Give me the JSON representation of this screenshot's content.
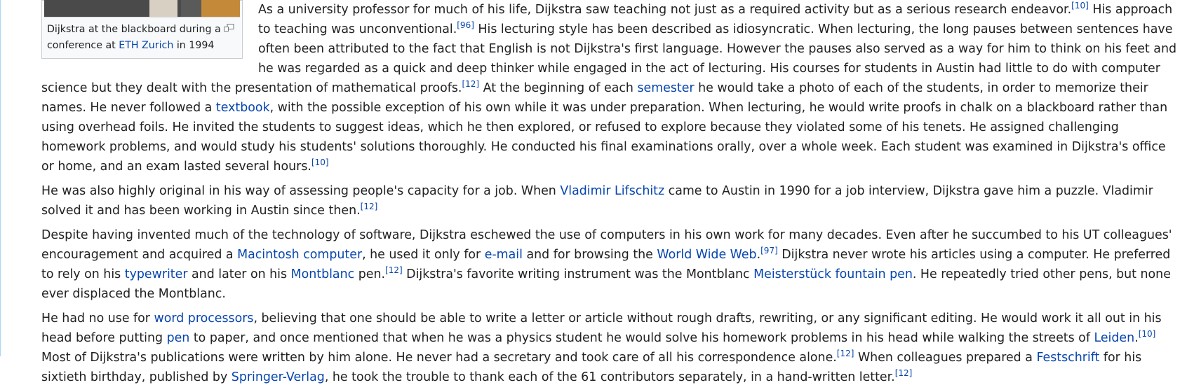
{
  "thumb": {
    "caption_pre": "Dijkstra at the blackboard during a conference at ",
    "caption_link": "ETH Zurich",
    "caption_post": " in 1994"
  },
  "paragraphs": {
    "p1": {
      "t1": "As a university professor for much of his life, Dijkstra saw teaching not just as a required activity but as a serious research endeavor.",
      "r1": "[10]",
      "t2": " His approach to teaching was unconventional.",
      "r2": "[96]",
      "t3": " His lecturing style has been described as idiosyncratic. When lecturing, the long pauses between sentences have often been attributed to the fact that English is not Dijkstra's first language. However the pauses also served as a way for him to think on his feet and he was regarded as a quick and deep thinker while engaged in the act of lecturing. His courses for students in Austin had little to do with computer science but they dealt with the presentation of mathematical proofs.",
      "r3": "[12]",
      "t4": " At the beginning of each ",
      "l1": "semester",
      "t5": " he would take a photo of each of the students, in order to memorize their names. He never followed a ",
      "l2": "textbook",
      "t6": ", with the possible exception of his own while it was under preparation. When lecturing, he would write proofs in chalk on a blackboard rather than using overhead foils. He invited the students to suggest ideas, which he then explored, or refused to explore because they violated some of his tenets. He assigned challenging homework problems, and would study his students' solutions thoroughly. He conducted his final examinations orally, over a whole week. Each student was examined in Dijkstra's office or home, and an exam lasted several hours.",
      "r4": "[10]"
    },
    "p2": {
      "t1": "He was also highly original in his way of assessing people's capacity for a job. When ",
      "l1": "Vladimir Lifschitz",
      "t2": " came to Austin in 1990 for a job interview, Dijkstra gave him a puzzle. Vladimir solved it and has been working in Austin since then.",
      "r1": "[12]"
    },
    "p3": {
      "t1": "Despite having invented much of the technology of software, Dijkstra eschewed the use of computers in his own work for many decades. Even after he succumbed to his UT colleagues' encouragement and acquired a ",
      "l1": "Macintosh computer",
      "t2": ", he used it only for ",
      "l2": "e-mail",
      "t3": " and for browsing the ",
      "l3": "World Wide Web",
      "t4": ".",
      "r1": "[97]",
      "t5": " Dijkstra never wrote his articles using a computer. He preferred to rely on his ",
      "l4": "typewriter",
      "t6": " and later on his ",
      "l5": "Montblanc",
      "t7": " pen.",
      "r2": "[12]",
      "t8": " Dijkstra's favorite writing instrument was the Montblanc ",
      "l6": "Meisterstück fountain pen",
      "t9": ". He repeatedly tried other pens, but none ever displaced the Montblanc."
    },
    "p4": {
      "t1": "He had no use for ",
      "l1": "word processors",
      "t2": ", believing that one should be able to write a letter or article without rough drafts, rewriting, or any significant editing. He would work it all out in his head before putting ",
      "l2": "pen",
      "t3": " to paper, and once mentioned that when he was a physics student he would solve his homework problems in his head while walking the streets of ",
      "l3": "Leiden",
      "t4": ".",
      "r1": "[10]",
      "t5": " Most of Dijkstra's publications were written by him alone. He never had a secretary and took care of all his correspondence alone.",
      "r2": "[12]",
      "t6": " When colleagues prepared a ",
      "l4": "Festschrift",
      "t7": " for his sixtieth birthday, published by ",
      "l5": "Springer-Verlag",
      "t8": ", he took the trouble to thank each of the 61 contributors separately, in a hand-written letter.",
      "r3": "[12]"
    }
  }
}
